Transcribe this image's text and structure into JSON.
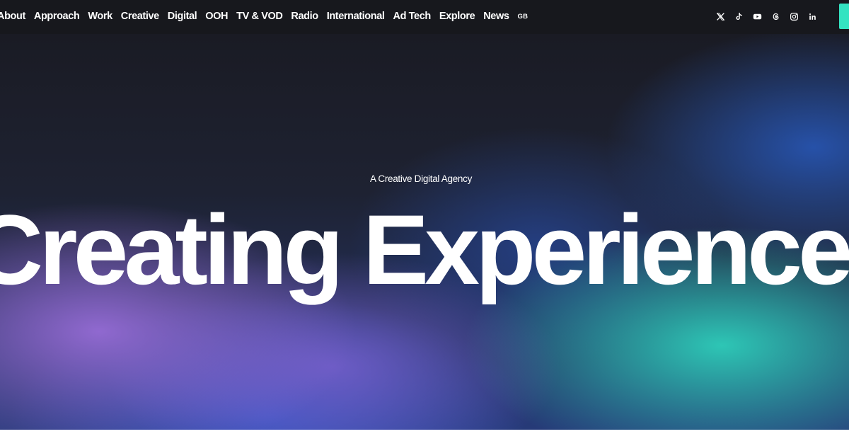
{
  "nav": {
    "links": [
      {
        "label": "About"
      },
      {
        "label": "Approach"
      },
      {
        "label": "Work"
      },
      {
        "label": "Creative"
      },
      {
        "label": "Digital"
      },
      {
        "label": "OOH"
      },
      {
        "label": "TV & VOD"
      },
      {
        "label": "Radio"
      },
      {
        "label": "International"
      },
      {
        "label": "Ad Tech"
      },
      {
        "label": "Explore"
      },
      {
        "label": "News"
      }
    ],
    "locale": "GB"
  },
  "social": {
    "icons": [
      "x-icon",
      "tiktok-icon",
      "youtube-icon",
      "threads-icon",
      "instagram-icon",
      "linkedin-icon"
    ]
  },
  "hero": {
    "tagline": "A Creative Digital Agency",
    "headline": "Creating Experiences"
  },
  "colors": {
    "nav_background": "#17181d",
    "accent": "#34e3c1",
    "text": "#ffffff"
  }
}
